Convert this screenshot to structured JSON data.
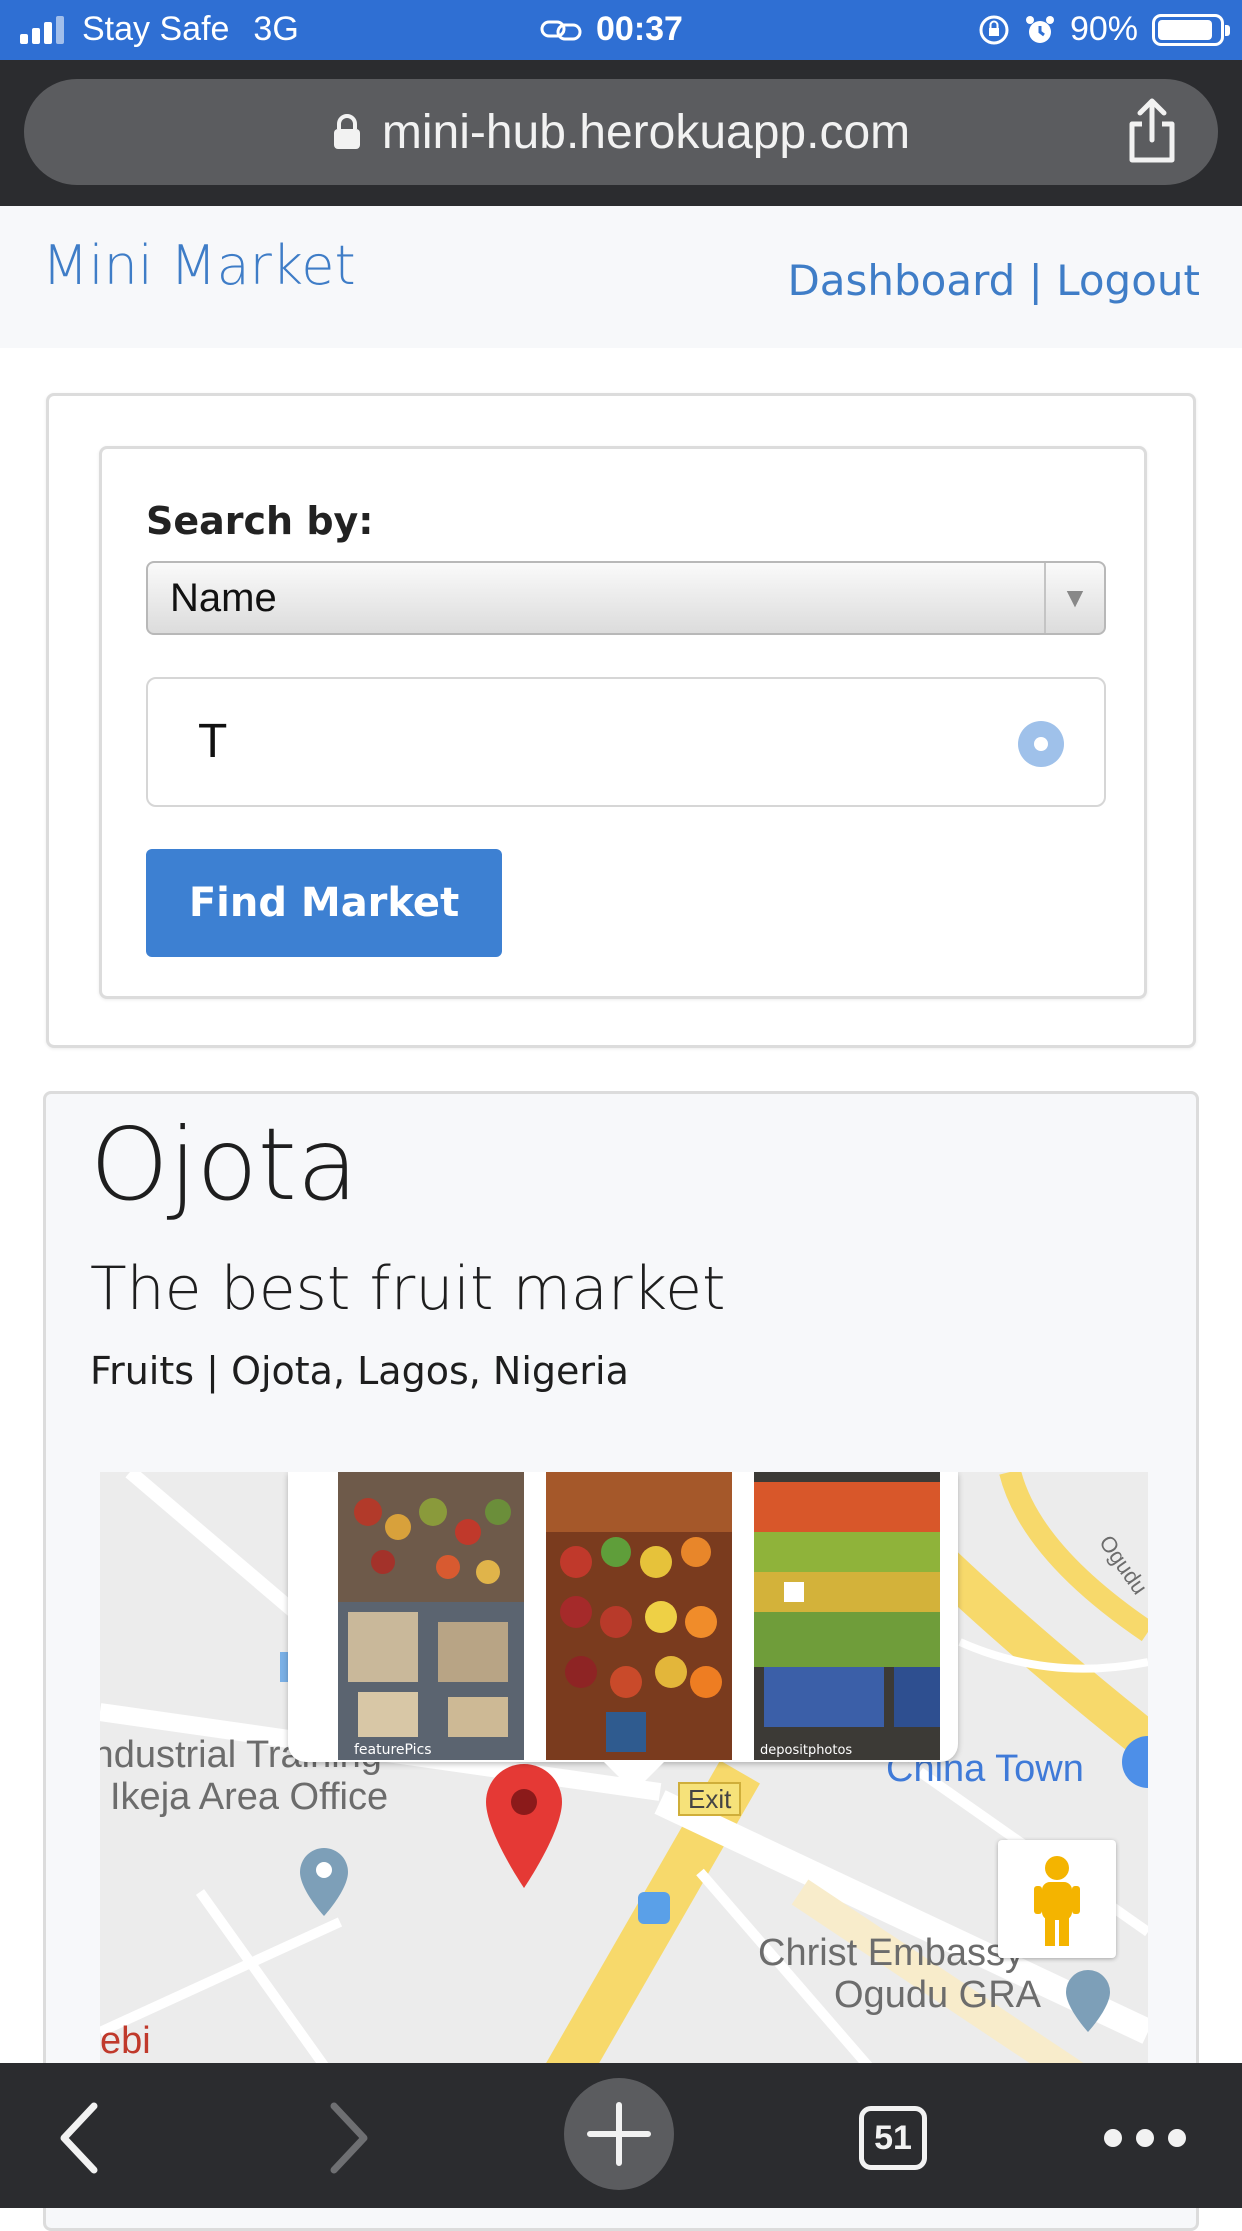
{
  "status_bar": {
    "carrier": "Stay Safe",
    "network": "3G",
    "time": "00:37",
    "battery": "90%",
    "battery_level": 0.9
  },
  "browser": {
    "url": "mini-hub.herokuapp.com",
    "tab_count": "51"
  },
  "navbar": {
    "brand": "Mini Market",
    "links": [
      "Dashboard",
      "Logout"
    ],
    "separator": "|"
  },
  "search": {
    "label": "Search by:",
    "selected_option": "Name",
    "query_value": "T",
    "button_label": "Find Market"
  },
  "market": {
    "name": "Ojota",
    "description": "The best fruit market",
    "category": "Fruits",
    "location": "Ojota, Lagos, Nigeria",
    "meta_separator": "|"
  },
  "map": {
    "labels": {
      "industrial_1": "Industrial Training",
      "industrial_2": "Ikeja Area Office",
      "china_town": "China Town",
      "christ_1": "Christ Embassy",
      "christ_2": "Ogudu GRA",
      "left_edge": "ebi",
      "exit": "Exit",
      "ogudu": "Ogudu"
    },
    "photo_watermarks": [
      "featurePics",
      "depositphotos"
    ]
  },
  "colors": {
    "status_bar": "#2f6fd3",
    "brand_blue": "#3f7dc7",
    "button_blue": "#3d80d2",
    "browser_chrome": "#2b2c2f"
  }
}
